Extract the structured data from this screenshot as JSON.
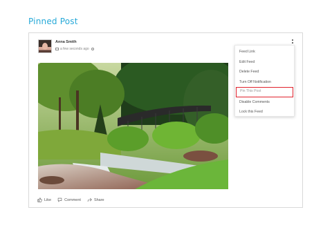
{
  "page": {
    "title": "Pinned Post"
  },
  "post": {
    "author": "Anna Smith",
    "timestamp": "a few seconds ago",
    "image": "park-waterfall-photo"
  },
  "menu": {
    "items": [
      {
        "label": "Feed Link"
      },
      {
        "label": "Edit Feed"
      },
      {
        "label": "Delete Feed"
      },
      {
        "label": "Turn Off Notification"
      },
      {
        "label": "Pin This Post",
        "highlighted": true
      },
      {
        "label": "Disable Comments"
      },
      {
        "label": "Lock this Feed"
      }
    ]
  },
  "actions": {
    "like_label": "Like",
    "comment_label": "Comment",
    "share_label": "Share"
  },
  "colors": {
    "accent": "#26a9d8",
    "highlight_border": "#e0202b"
  }
}
